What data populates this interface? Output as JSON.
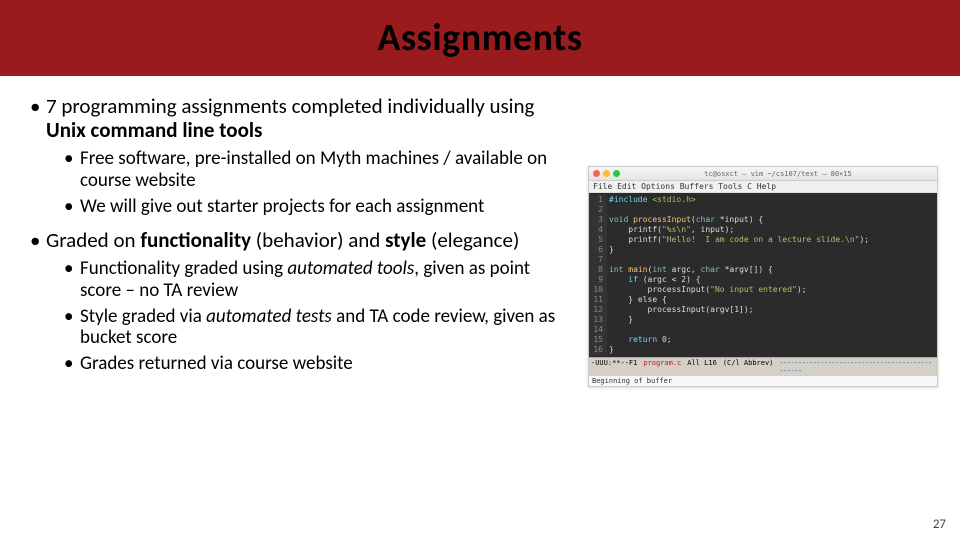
{
  "header": {
    "title": "Assignments"
  },
  "bullets": {
    "b1": {
      "pre": "7 programming assignments completed individually using ",
      "bold": "Unix command line tools",
      "sub1": "Free software, pre-installed on Myth machines / available on course website",
      "sub2": "We will give out starter projects for each assignment"
    },
    "b2": {
      "pre": "Graded on ",
      "bold1": "functionality",
      "mid1": " (behavior) and ",
      "bold2": "style",
      "post": " (elegance)",
      "sub1a": "Functionality graded using ",
      "sub1i": "automated tools",
      "sub1b": ", given as point score – no TA review",
      "sub2a": "Style graded via ",
      "sub2i": "automated tests",
      "sub2b": " and TA code review, given as bucket score",
      "sub3": "Grades returned via course website"
    }
  },
  "figure": {
    "window_title": "tc@osxct — vim ~/cs107/text — 80×15",
    "menubar": "File Edit Options Buffers Tools C Help",
    "code": {
      "l1a": "#include",
      "l1b": " <stdio.h>",
      "l3a": "void ",
      "l3b": "processInput",
      "l3c": "(",
      "l3d": "char",
      "l3e": " *input) {",
      "l4a": "    printf(",
      "l4b": "\"%s\\n\"",
      "l4c": ", input);",
      "l5a": "    printf(",
      "l5b": "\"Hello!  I am code on a lecture slide.\\n\"",
      "l5c": ");",
      "l6": "}",
      "l8a": "int ",
      "l8b": "main",
      "l8c": "(",
      "l8d": "int",
      "l8e": " argc, ",
      "l8f": "char",
      "l8g": " *argv[]) {",
      "l9a": "    if",
      "l9b": " (argc < 2) {",
      "l10a": "        processInput(",
      "l10b": "\"No input entered\"",
      "l10c": ");",
      "l11": "    } else {",
      "l12": "        processInput(argv[1]);",
      "l13": "    }",
      "l15a": "    return",
      "l15b": " 0;",
      "l16": "}"
    },
    "status": {
      "left": "-UUU:**--F1",
      "file": "program.c",
      "pos": "All L16",
      "mode": "(C/l Abbrev)"
    },
    "minibuffer": "Beginning of buffer"
  },
  "page_number": "27"
}
